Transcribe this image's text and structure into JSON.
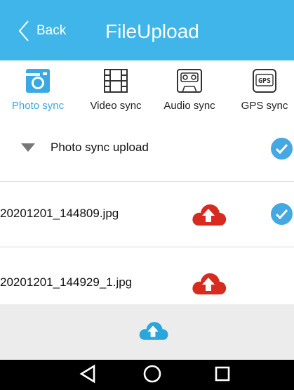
{
  "header": {
    "back_label": "Back",
    "title": "FileUpload"
  },
  "tabs": [
    {
      "label": "Photo sync",
      "icon": "camera-icon",
      "active": true
    },
    {
      "label": "Video sync",
      "icon": "film-icon",
      "active": false
    },
    {
      "label": "Audio sync",
      "icon": "cassette-icon",
      "active": false
    },
    {
      "label": "GPS sync",
      "icon": "gps-icon",
      "active": false,
      "icon_text": "GPS"
    }
  ],
  "section": {
    "label": "Photo sync upload",
    "checked": true
  },
  "files": [
    {
      "name": "20201201_144809.jpg",
      "status_icon": "cloud-upload-icon",
      "checked": true
    },
    {
      "name": "20201201_144929_1.jpg",
      "status_icon": "cloud-upload-icon",
      "checked": false
    }
  ],
  "colors": {
    "header": "#3fb5ea",
    "accent": "#3aa8e4",
    "upload_red": "#d82a1f",
    "upload_blue": "#2aa6dc",
    "bar_bg": "#ececec"
  }
}
